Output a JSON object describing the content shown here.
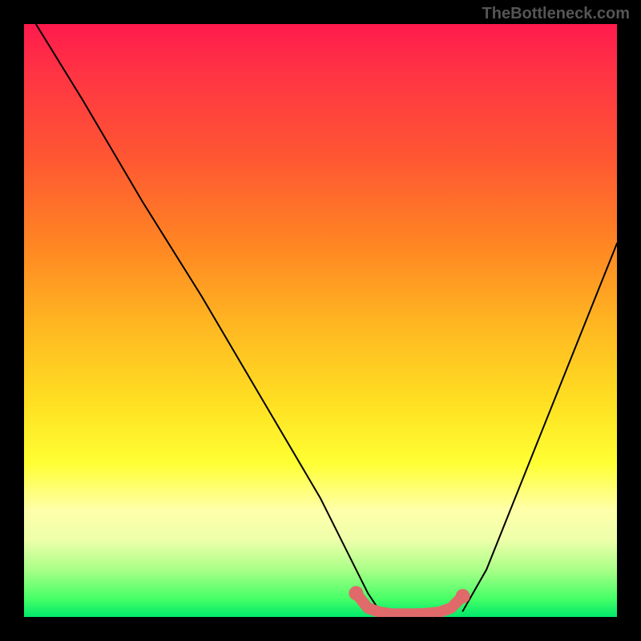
{
  "watermark": "TheBottleneck.com",
  "chart_data": {
    "type": "line",
    "title": "",
    "xlabel": "",
    "ylabel": "",
    "xlim": [
      0,
      100
    ],
    "ylim": [
      0,
      100
    ],
    "series": [
      {
        "name": "left-curve",
        "x": [
          2,
          10,
          20,
          30,
          40,
          50,
          56,
          58,
          60
        ],
        "values": [
          100,
          87,
          70,
          54,
          37,
          20,
          8,
          4,
          1
        ],
        "color": "#000000"
      },
      {
        "name": "right-curve",
        "x": [
          74,
          78,
          82,
          86,
          90,
          94,
          98,
          100
        ],
        "values": [
          1,
          8,
          18,
          28,
          38,
          48,
          58,
          63
        ],
        "color": "#000000"
      },
      {
        "name": "bottom-highlight",
        "x": [
          56,
          58,
          60,
          62,
          64,
          66,
          68,
          70,
          72,
          74
        ],
        "values": [
          4,
          1.5,
          0.8,
          0.5,
          0.5,
          0.5,
          0.6,
          0.8,
          1.5,
          3.5
        ],
        "color": "#e06a6a"
      }
    ],
    "background_gradient": {
      "top": "#ff1a4d",
      "mid": "#ffe022",
      "bottom": "#00e96b"
    }
  }
}
